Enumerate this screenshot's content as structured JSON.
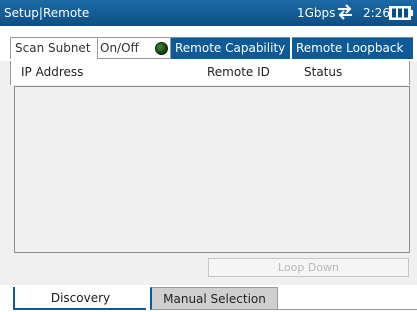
{
  "titlebar": {
    "title": "Setup|Remote",
    "speed": "1Gbps",
    "clock": "2:26",
    "link_icon": "link-arrows-icon",
    "battery_icon": "battery-icon"
  },
  "toolbar": {
    "scan_subnet_label": "Scan Subnet",
    "onoff_label": "On/Off",
    "led_state": "off",
    "remote_capability_label": "Remote Capability",
    "remote_loopback_label": "Remote Loopback"
  },
  "table": {
    "columns": [
      "IP Address",
      "Remote ID",
      "Status"
    ],
    "rows": []
  },
  "actions": {
    "loop_down_label": "Loop Down",
    "loop_down_enabled": false
  },
  "tabs": [
    {
      "label": "Discovery",
      "active": true
    },
    {
      "label": "Manual Selection",
      "active": false
    }
  ],
  "colors": {
    "accent": "#0e5a97",
    "titlebar": "#1d6aa6",
    "led": "#0b3d0b"
  }
}
